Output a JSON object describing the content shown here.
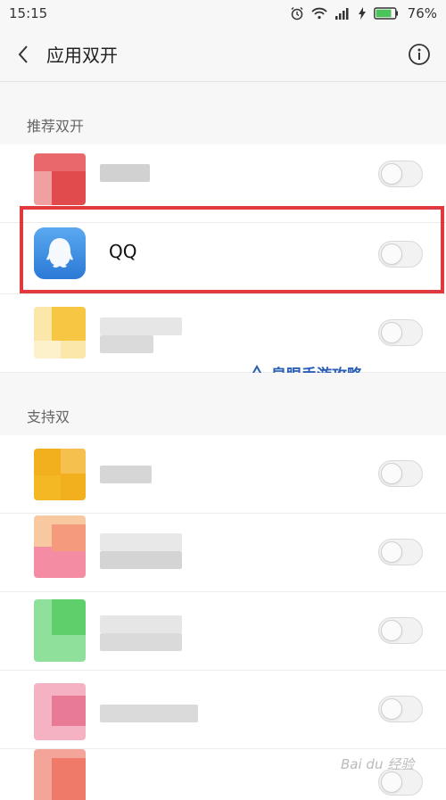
{
  "status_bar": {
    "time": "15:15",
    "battery_percent": "76%"
  },
  "header": {
    "title": "应用双开",
    "back_icon": "chevron-left-icon",
    "info_icon": "info-circle-icon"
  },
  "sections": {
    "recommended": {
      "title": "推荐双开"
    },
    "supported": {
      "title": "支持双"
    }
  },
  "recommended_apps": [
    {
      "name": "",
      "blurred": true,
      "icon_color": "#e24b4e",
      "toggle_on": false
    },
    {
      "name": "QQ",
      "blurred": false,
      "icon_color": "#3a8ee6",
      "toggle_on": false
    },
    {
      "name": "",
      "blurred": true,
      "icon_color": "#f7c744",
      "toggle_on": false
    }
  ],
  "supported_apps": [
    {
      "name": "",
      "blurred": true,
      "icon_color": "#f2b01e",
      "toggle_on": false
    },
    {
      "name": "",
      "blurred": true,
      "icon_color": "#f59a7c",
      "toggle_on": false
    },
    {
      "name": "",
      "blurred": true,
      "icon_color": "#5fcf6c",
      "toggle_on": false
    },
    {
      "name": "",
      "blurred": true,
      "icon_color": "#e97a95",
      "toggle_on": false
    },
    {
      "name": "",
      "blurred": true,
      "icon_color": "#f07a6a",
      "toggle_on": false
    }
  ],
  "watermark": {
    "text": "泉眼手游攻略"
  },
  "baidu_watermark": {
    "text": "Bai du 经验"
  },
  "colors": {
    "highlight": "#e0393e",
    "watermark": "#2b5fb5",
    "qq_icon": "#3a8ee6"
  }
}
